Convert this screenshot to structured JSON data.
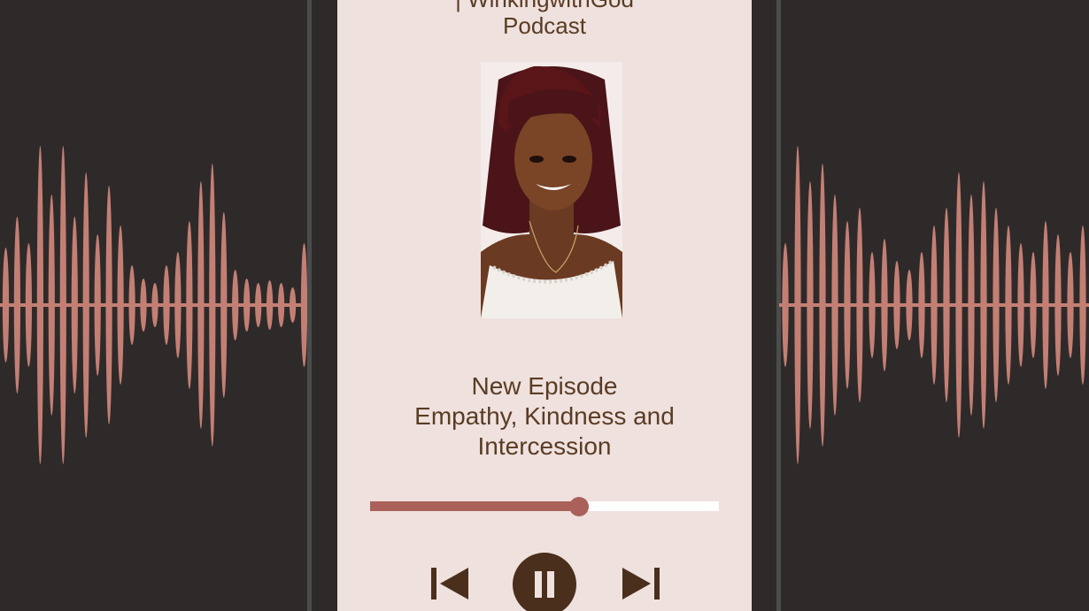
{
  "podcast": {
    "title_line1": "| WinkingwithGod",
    "title_line2": "Podcast"
  },
  "cover": {
    "alt": "Podcast host photo"
  },
  "episode": {
    "label": "New Episode",
    "title_line1": "Empathy, Kindness and",
    "title_line2": "Intercession"
  },
  "player": {
    "progress_fraction": 0.6,
    "state": "playing",
    "controls": [
      "previous-track",
      "pause",
      "next-track"
    ]
  },
  "colors": {
    "background": "#2e2a2a",
    "card": "#efe1de",
    "text": "#5a3c24",
    "accent": "#a9615a",
    "wave": "#c47f74"
  },
  "icons": [
    "skip-previous-icon",
    "pause-icon",
    "skip-next-icon"
  ]
}
